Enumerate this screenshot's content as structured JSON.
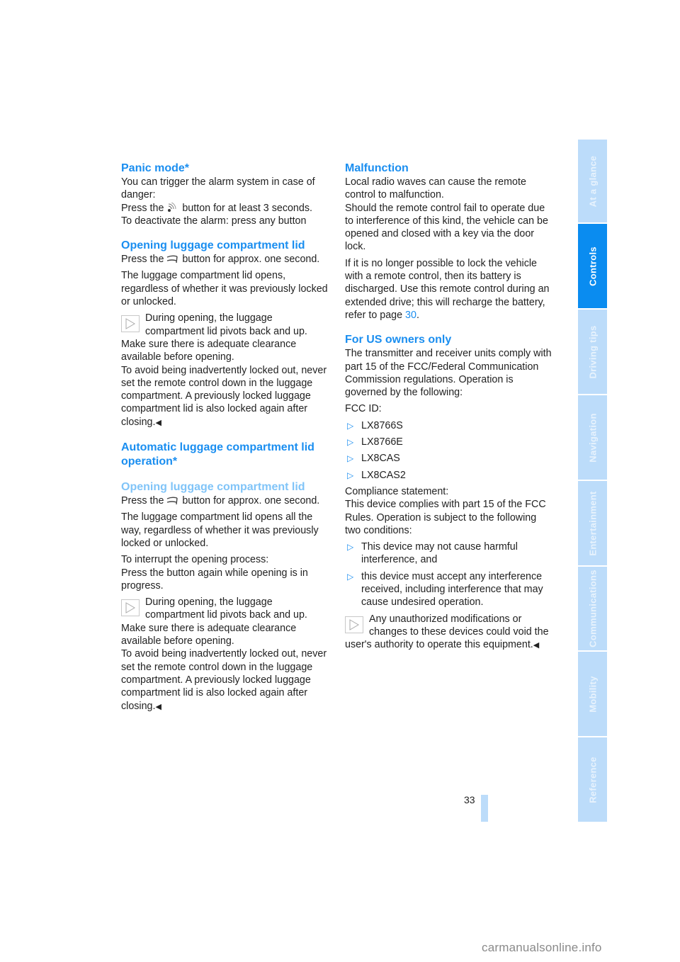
{
  "left_column": {
    "panic": {
      "heading": "Panic mode*",
      "p1": "You can trigger the alarm system in case of danger:",
      "p2_pre": "Press the ",
      "p2_icon": "panic-alarm-icon",
      "p2_post": " button for at least 3 seconds.",
      "p3": "To deactivate the alarm: press any button"
    },
    "opening": {
      "heading": "Opening luggage compartment lid",
      "p1_pre": "Press the ",
      "p1_icon": "trunk-lid-icon",
      "p1_post": " button for approx. one second.",
      "p2": "The luggage compartment lid opens, regardless of whether it was previously locked or unlocked.",
      "note_icon": "note-triangle-icon",
      "note1": "During opening, the luggage compartment lid pivots back and up. Make sure there is adequate clearance available before opening.",
      "note2": "To avoid being inadvertently locked out, never set the remote control down in the luggage compartment. A previously locked luggage compartment lid is also locked again after closing.",
      "end_mark": "◀"
    },
    "automatic": {
      "heading": "Automatic luggage compartment lid operation*",
      "subheading": "Opening luggage compartment lid",
      "p1_pre": "Press the ",
      "p1_icon": "trunk-lid-icon",
      "p1_post": " button for approx. one second.",
      "p2": "The luggage compartment lid opens all the way, regardless of whether it was previously locked or unlocked.",
      "p3a": "To interrupt the opening process:",
      "p3b": "Press the button again while opening is in progress.",
      "note1": "During opening, the luggage compartment lid pivots back and up. Make sure there is adequate clearance available before opening.",
      "note2": "To avoid being inadvertently locked out, never set the remote control down in the luggage compartment. A previously locked luggage compartment lid is also locked again after closing.",
      "end_mark": "◀"
    }
  },
  "right_column": {
    "malfunction": {
      "heading": "Malfunction",
      "p1a": "Local radio waves can cause the remote control to malfunction.",
      "p1b": "Should the remote control fail to operate due to interference of this kind, the vehicle can be opened and closed with a key via the door lock.",
      "p2": "If it is no longer possible to lock the vehicle with a remote control, then its battery is discharged. Use this remote control during an extended drive; this will recharge the battery, refer to page ",
      "page_link": "30",
      "p2_end": "."
    },
    "us_owners": {
      "heading": "For US owners only",
      "p1": "The transmitter and receiver units comply with part 15 of the FCC/Federal Communication Commission regulations. Operation is governed by the following:",
      "fcc_label": "FCC ID:",
      "bullet_glyph": "▷",
      "fcc_ids": [
        "LX8766S",
        "LX8766E",
        "LX8CAS",
        "LX8CAS2"
      ],
      "compliance_label": "Compliance statement:",
      "compliance_text": "This device complies with part 15 of the FCC Rules. Operation is subject to the following two conditions:",
      "conditions": [
        "This device may not cause harmful interference, and",
        "this device must accept any interference received, including interference that may cause undesired operation."
      ],
      "note": "Any unauthorized modifications or changes to these devices could void the user's authority to operate this equipment.",
      "end_mark": "◀"
    }
  },
  "sidebar": {
    "tabs": [
      {
        "label": "At a glance",
        "active": false
      },
      {
        "label": "Controls",
        "active": true
      },
      {
        "label": "Driving tips",
        "active": false
      },
      {
        "label": "Navigation",
        "active": false
      },
      {
        "label": "Entertainment",
        "active": false
      },
      {
        "label": "Communications",
        "active": false
      },
      {
        "label": "Mobility",
        "active": false
      },
      {
        "label": "Reference",
        "active": false
      }
    ]
  },
  "page_number": "33",
  "watermark": "carmanualsonline.info",
  "colors": {
    "heading": "#1a8ef0",
    "subheading": "#80c4f8",
    "tab_active": "#0a8cf0",
    "tab_inactive": "#bcdcfa"
  }
}
